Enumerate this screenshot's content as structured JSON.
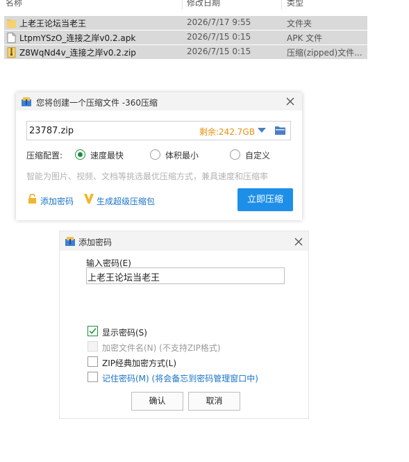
{
  "explorer": {
    "columns": {
      "name": "名称",
      "modified": "修改日期",
      "type": "类型"
    },
    "rows": [
      {
        "name": "上老王论坛当老王",
        "modified": "2026/7/17 9:55",
        "type": "文件夹",
        "icon": "folder-icon"
      },
      {
        "name": "LtpmYSzO_连接之岸v0.2.apk",
        "modified": "2026/7/15 0:15",
        "type": "APK 文件",
        "icon": "file-icon"
      },
      {
        "name": "Z8WqNd4v_连接之岸v0.2.zip",
        "modified": "2026/7/15 0:15",
        "type": "压缩(zipped)文件...",
        "icon": "zip-icon"
      }
    ]
  },
  "compress_dialog": {
    "title": "您将创建一个压缩文件 -360压缩",
    "filename": "23787.zip",
    "remaining": "剩余:242.7GB",
    "config_label": "压缩配置:",
    "options": [
      {
        "label": "速度最快",
        "selected": true
      },
      {
        "label": "体积最小",
        "selected": false
      },
      {
        "label": "自定义",
        "selected": false
      }
    ],
    "hint": "智能为图片、视频、文档等挑选最优压缩方式，兼具速度和压缩率",
    "add_password_link": "添加密码",
    "super_compress_link": "生成超级压缩包",
    "compress_button": "立即压缩"
  },
  "password_dialog": {
    "title": "添加密码",
    "input_label": "输入密码(E)",
    "password_value": "上老王论坛当老王",
    "checkboxes": [
      {
        "label": "显示密码(S)",
        "checked": true,
        "disabled": false
      },
      {
        "label": "加密文件名(N) (不支持ZIP格式)",
        "checked": false,
        "disabled": true
      },
      {
        "label": "ZIP经典加密方式(L)",
        "checked": false,
        "disabled": false
      },
      {
        "label": "记住密码(M) (将会备忘到密码管理窗口中)",
        "checked": false,
        "disabled": false
      }
    ],
    "ok_button": "确认",
    "cancel_button": "取消"
  },
  "colors": {
    "accent": "#1e8fe8",
    "remaining": "#e8900c",
    "check_green": "#1a8d3c",
    "link_blue": "#1a73c8"
  }
}
